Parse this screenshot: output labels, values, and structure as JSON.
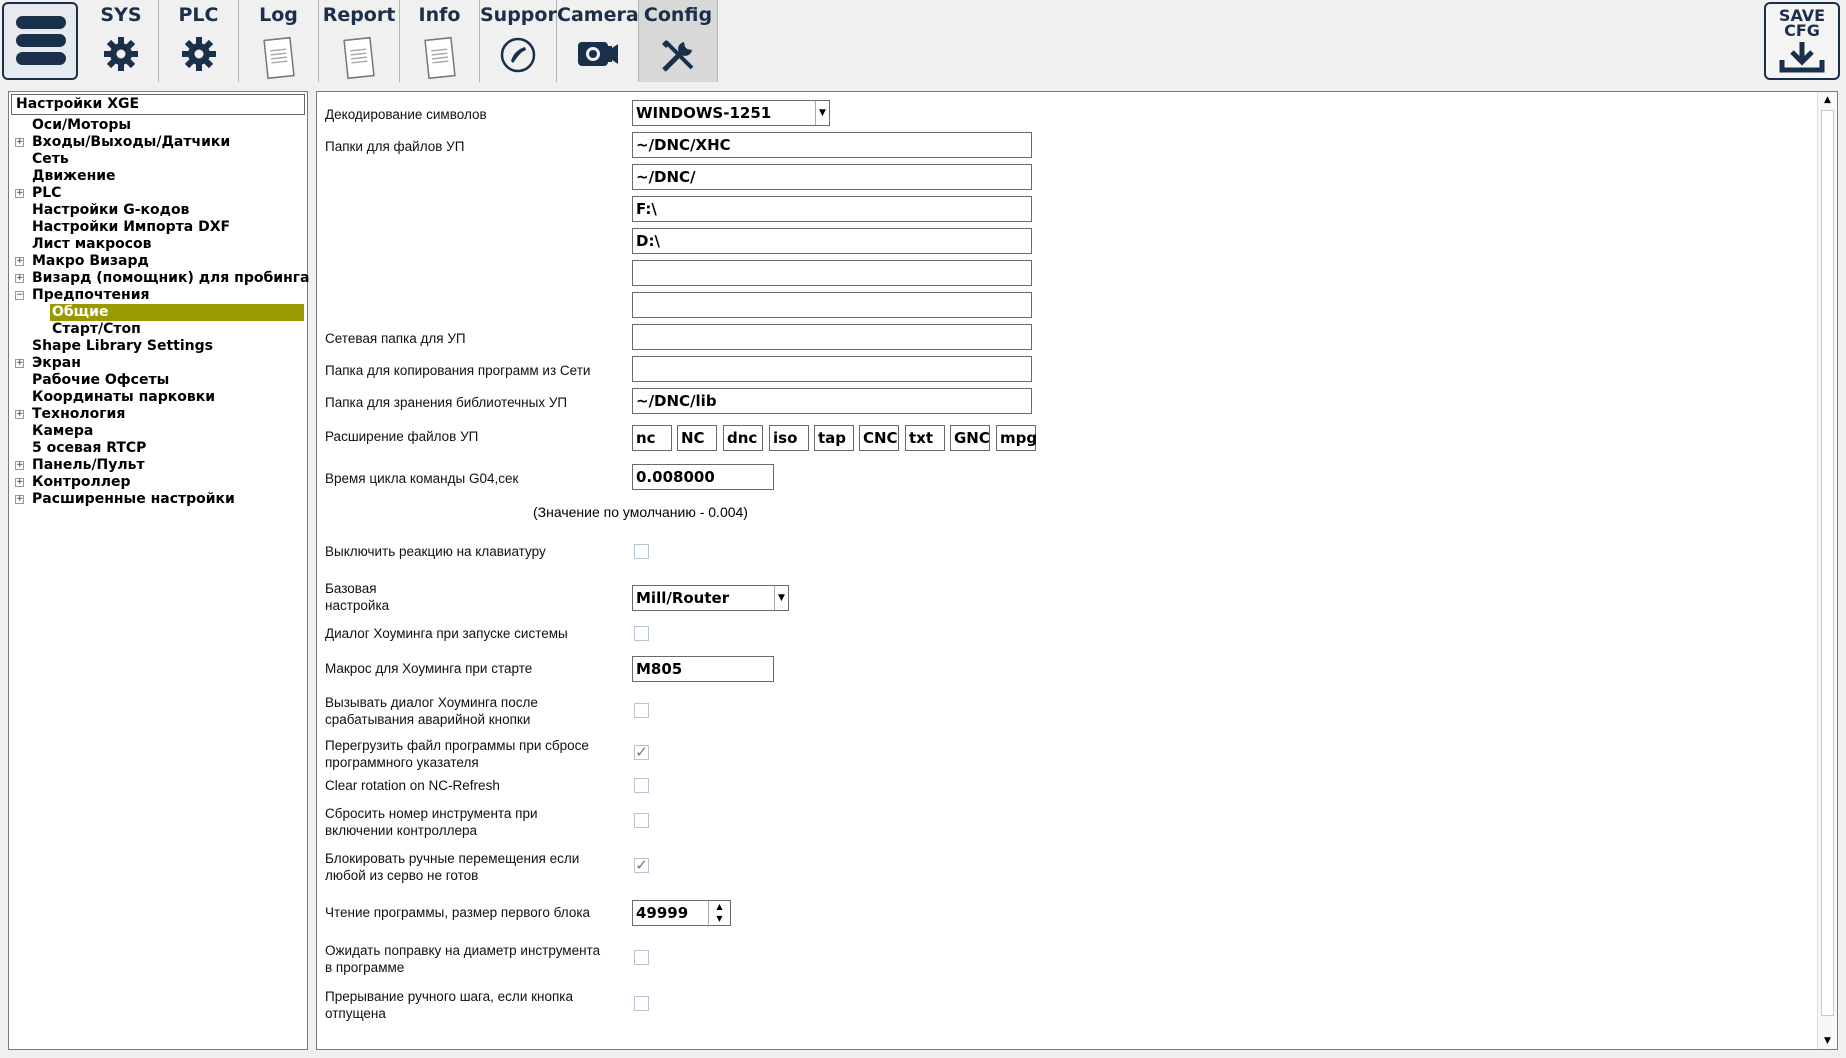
{
  "toolbar": {
    "tabs": [
      {
        "label": "SYS",
        "icon": "gear-icon"
      },
      {
        "label": "PLC",
        "icon": "gear-icon"
      },
      {
        "label": "Log",
        "icon": "document-icon"
      },
      {
        "label": "Report",
        "icon": "document-icon"
      },
      {
        "label": "Info",
        "icon": "document-icon"
      },
      {
        "label": "Support",
        "icon": "phone-icon"
      },
      {
        "label": "Camera",
        "icon": "camera-icon"
      },
      {
        "label": "Config",
        "icon": "tools-icon"
      }
    ],
    "active_tab": "Config",
    "save_label": "SAVE\nCFG"
  },
  "tree": {
    "root": "Настройки XGE",
    "items": [
      {
        "label": "Оси/Моторы",
        "expand": ""
      },
      {
        "label": "Входы/Выходы/Датчики",
        "expand": "+"
      },
      {
        "label": "Сеть",
        "expand": ""
      },
      {
        "label": "Движение",
        "expand": ""
      },
      {
        "label": "PLC",
        "expand": "+"
      },
      {
        "label": "Настройки G-кодов",
        "expand": ""
      },
      {
        "label": "Настройки Импорта DXF",
        "expand": ""
      },
      {
        "label": "Лист макросов",
        "expand": ""
      },
      {
        "label": "Макро Визард",
        "expand": "+"
      },
      {
        "label": "Визард (помощник) для пробинга",
        "expand": "+"
      },
      {
        "label": "Предпочтения",
        "expand": "−"
      },
      {
        "label": "Общие",
        "expand": "",
        "child": true,
        "selected": true
      },
      {
        "label": "Старт/Стоп",
        "expand": "",
        "child": true
      },
      {
        "label": "Shape Library Settings",
        "expand": ""
      },
      {
        "label": "Экран",
        "expand": "+"
      },
      {
        "label": "Рабочие Офсеты",
        "expand": ""
      },
      {
        "label": "Координаты парковки",
        "expand": ""
      },
      {
        "label": "Технология",
        "expand": "+"
      },
      {
        "label": "Камера",
        "expand": ""
      },
      {
        "label": "5 осевая RTCP",
        "expand": ""
      },
      {
        "label": "Панель/Пульт",
        "expand": "+"
      },
      {
        "label": "Контроллер",
        "expand": "+"
      },
      {
        "label": "Расширенные настройки",
        "expand": "+"
      }
    ]
  },
  "settings": {
    "decoding_label": "Декодирование символов",
    "decoding_value": "WINDOWS-1251",
    "folders_label": "Папки для файлов УП",
    "folders": [
      "~/DNC/XHC",
      "~/DNC/",
      "F:\\",
      "D:\\",
      "",
      ""
    ],
    "network_folder_label": "Сетевая папка для УП",
    "network_folder_value": "",
    "copy_folder_label": "Папка для копирования программ из Сети",
    "copy_folder_value": "",
    "library_folder_label": "Папка для зранения библиотечных УП",
    "library_folder_value": "~/DNC/lib",
    "extensions_label": "Расширение файлов УП",
    "extensions": [
      "nc",
      "NC",
      "dnc",
      "iso",
      "tap",
      "CNC",
      "txt",
      "GNC",
      "mpg"
    ],
    "g04_label": "Время цикла команды G04,сек",
    "g04_value": "0.008000",
    "g04_hint": "(Значение по умолчанию - 0.004)",
    "disable_keyboard_label": "Выключить реакцию на клавиатуру",
    "disable_keyboard_checked": false,
    "base_setup_label": "Базовая\nнастройка",
    "base_setup_value": "Mill/Router",
    "homing_dialog_label": "Диалог Хоуминга при запуске системы",
    "homing_dialog_checked": false,
    "homing_macro_label": "Макрос для Хоуминга при старте",
    "homing_macro_value": "M805",
    "homing_after_estop_label": "Вызывать диалог Хоуминга после\nсрабатывания аварийной кнопки",
    "homing_after_estop_checked": false,
    "reload_program_label": "Перегрузить файл программы при сбросе\nпрограммного указателя",
    "reload_program_checked": true,
    "clear_rotation_label": "Clear rotation on NC-Refresh",
    "clear_rotation_checked": false,
    "reset_tool_label": "Сбросить номер инструмента при\nвключении контроллера",
    "reset_tool_checked": false,
    "block_jog_label": "Блокировать ручные перемещения если\nлюбой из серво не готов",
    "block_jog_checked": true,
    "first_block_label": "Чтение программы, размер первого блока",
    "first_block_value": "49999",
    "wait_tool_diameter_label": "Ожидать поправку на диаметр инструмента\nв программе",
    "wait_tool_diameter_checked": false,
    "jog_interrupt_label": "Прерывание ручного шага, если кнопка\nотпущена",
    "jog_interrupt_checked": false
  },
  "colors": {
    "accent": "#1a2f4a",
    "selection": "#9a9a00"
  }
}
